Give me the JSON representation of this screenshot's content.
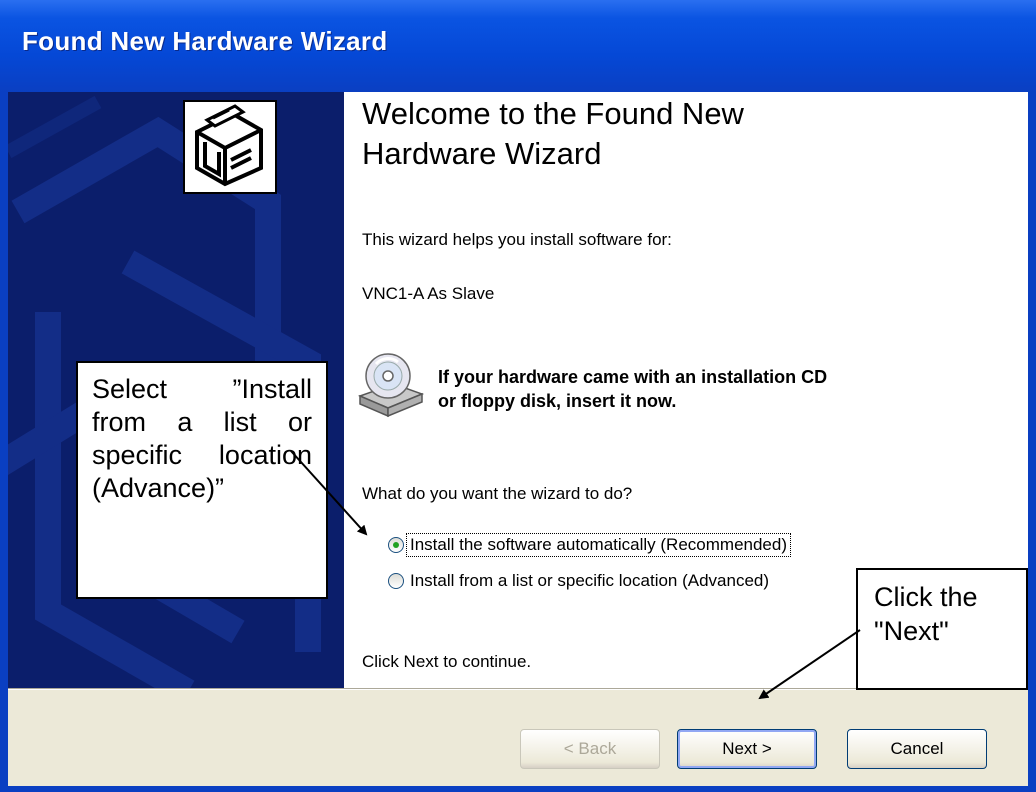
{
  "window": {
    "title": "Found New Hardware Wizard"
  },
  "content": {
    "heading_line1": "Welcome to the Found New",
    "heading_line2": "Hardware Wizard",
    "intro": "This wizard helps you install software for:",
    "device_name": "VNC1-A As Slave",
    "cd_line1": "If your hardware came with an installation CD",
    "cd_line2": "or floppy disk, insert it now.",
    "question": "What do you want the wizard to do?",
    "options": [
      {
        "label": "Install the software automatically (Recommended)",
        "selected": true
      },
      {
        "label": "Install from a list or specific location (Advanced)",
        "selected": false
      }
    ],
    "continue_text": "Click Next to continue."
  },
  "buttons": {
    "back": "< Back",
    "next": "Next >",
    "cancel": "Cancel"
  },
  "annotations": {
    "left_callout": "Select ”Install from a list or specific location (Advance)”",
    "right_callout": "Click the \"Next\""
  },
  "icons": {
    "wizard": "hardware-box-icon",
    "cd": "cd-drive-icon"
  },
  "colors": {
    "titlebar": "#0a54e2",
    "left_panel": "#081a63",
    "button_bar": "#ece9d8",
    "radio_selected": "#21a121"
  }
}
